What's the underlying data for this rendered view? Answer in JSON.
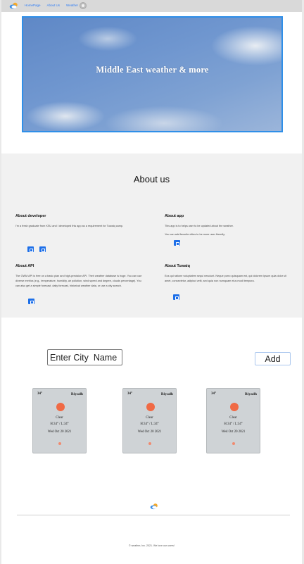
{
  "nav": {
    "links": [
      "HomePage",
      "About Us",
      "Weather"
    ],
    "accent": "#2f7df6"
  },
  "hero": {
    "title": "Middle East weather & more"
  },
  "about": {
    "heading": "About us",
    "developer": {
      "title": "About developer",
      "text": "I'm a fresh graduate from KSU and I developed this app as a requirement for Tuwaiq camp.",
      "icons": [
        "linkedin-icon",
        "github-icon"
      ]
    },
    "app": {
      "title": "About app",
      "text1": "This app is to helps user to be updated about the weather.",
      "text2": "You can add favorite cities to be more user friendly.",
      "icons": [
        "github-icon"
      ]
    },
    "api": {
      "title": "About API",
      "text": "The OWM API is free on a basic plan and high-precision API. Their weather database is huge. You can use diverse metrics (e.g., temperature, humidity, air pollution, wind speed and degree, clouds percentage). You can also get a simple forecast, daily forecast, historical weather data, or use a city search.",
      "icons": [
        "external-link-icon"
      ]
    },
    "tuwaiq": {
      "title": "About Tuwaiq",
      "text": "Eos qui ratione voluptatem sequi nesciunt. Neque porro quisquam est, qui dolorem ipsum quia dolor sit amet, consectetur, adipisci velit, sed quia non numquam eius modi tempora.",
      "icons": [
        "external-link-icon"
      ]
    }
  },
  "weather": {
    "input_placeholder": "Enter City  Name",
    "add_label": "Add",
    "cards": [
      {
        "temp": "34°",
        "city": "Riyadh",
        "condition": "Clear",
        "range": "H:34° / L:34°",
        "date": "Wed Oct 20 2021"
      },
      {
        "temp": "34°",
        "city": "Riyadh",
        "condition": "Clear",
        "range": "H:34° / L:34°",
        "date": "Wed Oct 20 2021"
      },
      {
        "temp": "34°",
        "city": "Riyadh",
        "condition": "Clear",
        "range": "H:34° / L:34°",
        "date": "Wed Oct 20 2021"
      }
    ],
    "sun_color": "#f06a45"
  },
  "footer": {
    "copyright": "© weather, Inc. 2021. We love our users!"
  }
}
